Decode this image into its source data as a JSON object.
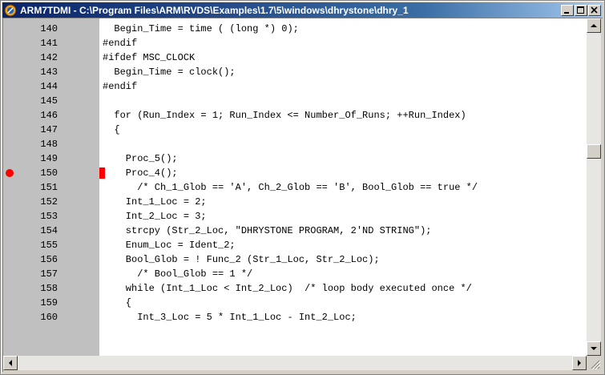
{
  "window": {
    "title": "ARM7TDMI - C:\\Program Files\\ARM\\RVDS\\Examples\\1.7\\5\\windows\\dhrystone\\dhry_1",
    "controls": {
      "minimize": "minimize",
      "maximize": "maximize",
      "close": "close"
    }
  },
  "colors": {
    "title_start": "#0a246a",
    "title_end": "#a6caf0",
    "gutter": "#c0c0c0",
    "breakpoint": "#ff0000"
  },
  "editor": {
    "breakpoint_line": "150",
    "lines": [
      {
        "num": "140",
        "code": "  Begin_Time = time ( (long *) 0);"
      },
      {
        "num": "141",
        "code": "#endif"
      },
      {
        "num": "142",
        "code": "#ifdef MSC_CLOCK"
      },
      {
        "num": "143",
        "code": "  Begin_Time = clock();"
      },
      {
        "num": "144",
        "code": "#endif"
      },
      {
        "num": "145",
        "code": ""
      },
      {
        "num": "146",
        "code": "  for (Run_Index = 1; Run_Index <= Number_Of_Runs; ++Run_Index)"
      },
      {
        "num": "147",
        "code": "  {"
      },
      {
        "num": "148",
        "code": ""
      },
      {
        "num": "149",
        "code": "    Proc_5();"
      },
      {
        "num": "150",
        "code": "    Proc_4();"
      },
      {
        "num": "151",
        "code": "      /* Ch_1_Glob == 'A', Ch_2_Glob == 'B', Bool_Glob == true */"
      },
      {
        "num": "152",
        "code": "    Int_1_Loc = 2;"
      },
      {
        "num": "153",
        "code": "    Int_2_Loc = 3;"
      },
      {
        "num": "154",
        "code": "    strcpy (Str_2_Loc, \"DHRYSTONE PROGRAM, 2'ND STRING\");"
      },
      {
        "num": "155",
        "code": "    Enum_Loc = Ident_2;"
      },
      {
        "num": "156",
        "code": "    Bool_Glob = ! Func_2 (Str_1_Loc, Str_2_Loc);"
      },
      {
        "num": "157",
        "code": "      /* Bool_Glob == 1 */"
      },
      {
        "num": "158",
        "code": "    while (Int_1_Loc < Int_2_Loc)  /* loop body executed once */"
      },
      {
        "num": "159",
        "code": "    {"
      },
      {
        "num": "160",
        "code": "      Int_3_Loc = 5 * Int_1_Loc - Int_2_Loc;"
      }
    ]
  },
  "scroll": {
    "vertical_position": 0.38
  }
}
